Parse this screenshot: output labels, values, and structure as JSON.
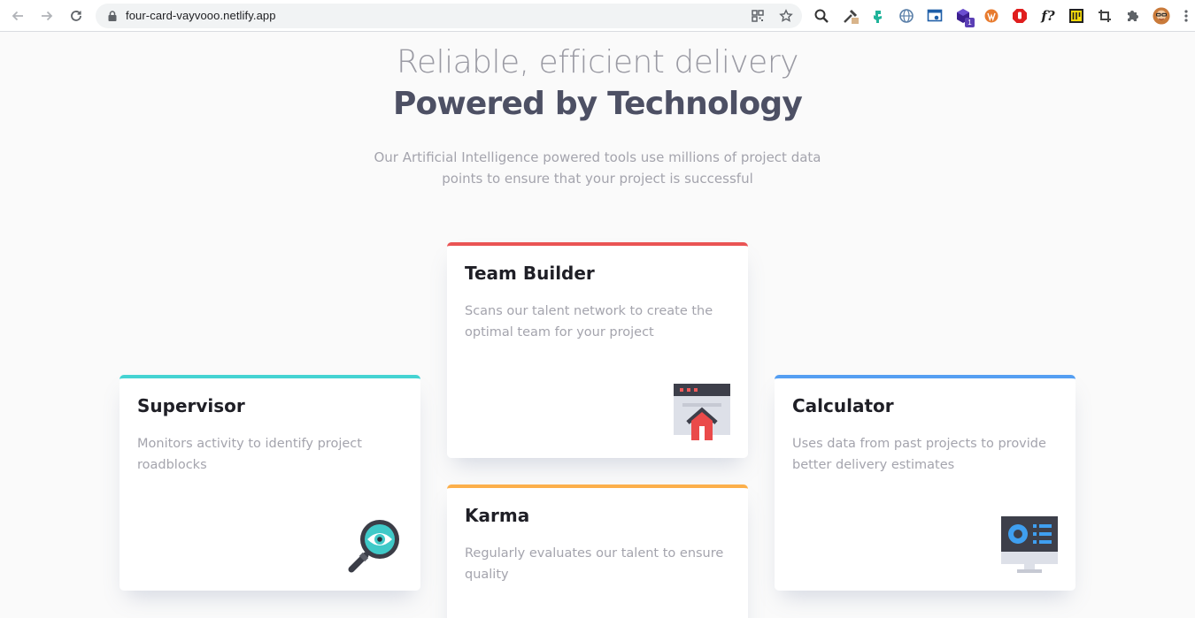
{
  "browser": {
    "url": "four-card-vayvooo.netlify.app",
    "extensions": [
      "qr-code-icon",
      "star-icon",
      "search-icon",
      "eyedropper-icon",
      "dino-icon",
      "globe-icon",
      "screenshot-icon",
      "cube-icon",
      "wordpress-icon",
      "stop-icon",
      "font-icon",
      "pi-icon",
      "crop-icon",
      "puzzle-icon",
      "avatar"
    ],
    "cube_badge": "1",
    "font_ext_label": "f?"
  },
  "hero": {
    "light_title": "Reliable, efficient delivery",
    "bold_title": "Powered by Technology",
    "description": "Our Artificial Intelligence powered tools use millions of project data points to ensure that your project is successful"
  },
  "cards": {
    "supervisor": {
      "title": "Supervisor",
      "description": "Monitors activity to identify project roadblocks",
      "accent": "#44d3d2",
      "icon": "magnifier-eye-icon"
    },
    "team_builder": {
      "title": "Team Builder",
      "description": "Scans our talent network to create the optimal team for your project",
      "accent": "#ea5454",
      "icon": "team-builder-icon"
    },
    "karma": {
      "title": "Karma",
      "description": "Regularly evaluates our talent to ensure quality",
      "accent": "#fcaf4a",
      "icon": "karma-icon"
    },
    "calculator": {
      "title": "Calculator",
      "description": "Uses data from past projects to provide better delivery estimates",
      "accent": "#549ef2",
      "icon": "calculator-monitor-icon"
    }
  }
}
